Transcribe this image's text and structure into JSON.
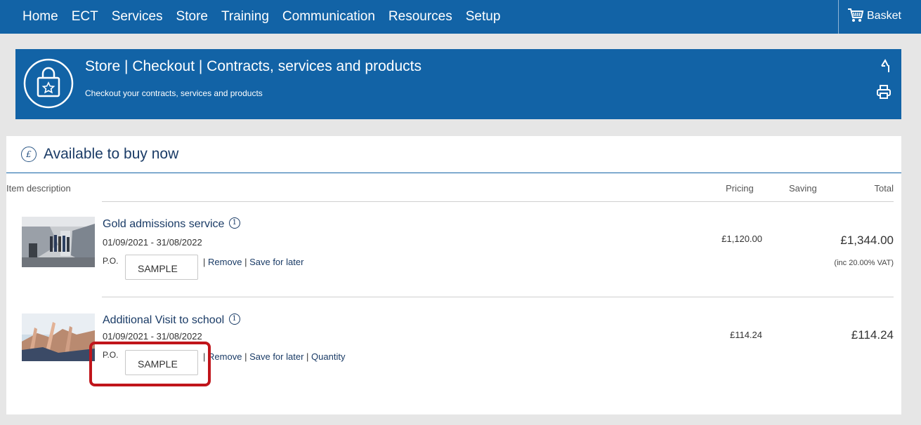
{
  "nav": {
    "items": [
      "Home",
      "ECT",
      "Services",
      "Store",
      "Training",
      "Communication",
      "Resources",
      "Setup"
    ],
    "basket_label": "Basket"
  },
  "header": {
    "title": "Store | Checkout | Contracts, services and products",
    "subtitle": "Checkout your contracts, services and products"
  },
  "section": {
    "title": "Available to buy now",
    "columns": {
      "description": "Item description",
      "pricing": "Pricing",
      "saving": "Saving",
      "total": "Total"
    }
  },
  "items": [
    {
      "name": "Gold admissions service",
      "dates": "01/09/2021 - 31/08/2022",
      "po_label": "P.O.",
      "po_value": "SAMPLE",
      "sep": "|",
      "remove": "Remove",
      "save_for_later": "Save for later",
      "quantity": "",
      "pricing": "£1,120.00",
      "total": "£1,344.00",
      "vat_note": "(inc 20.00% VAT)"
    },
    {
      "name": "Additional Visit to school",
      "dates": "01/09/2021 - 31/08/2022",
      "po_label": "P.O.",
      "po_value": "SAMPLE",
      "sep": "|",
      "remove": "Remove",
      "save_for_later": "Save for later",
      "quantity": "Quantity",
      "pricing": "£114.24",
      "total": "£114.24",
      "vat_note": ""
    }
  ],
  "colors": {
    "brand_blue": "#1263a6",
    "highlight": "#c0151b",
    "page_bg": "#e6e6e6"
  }
}
